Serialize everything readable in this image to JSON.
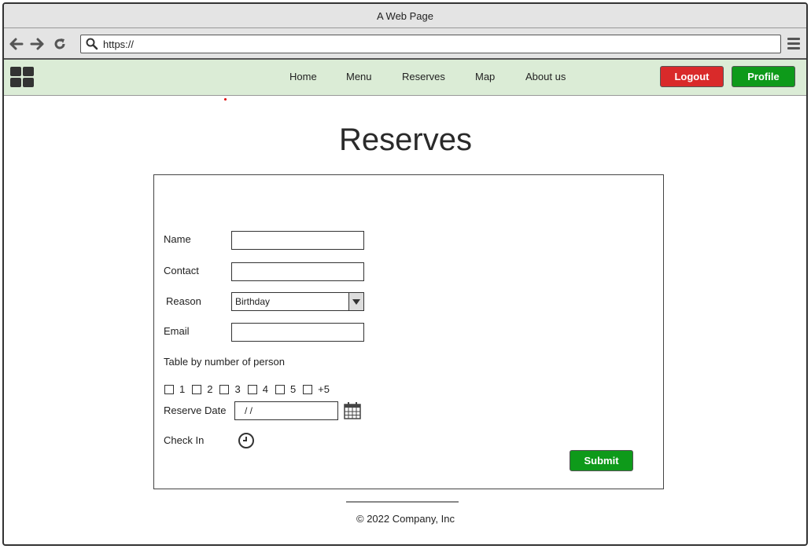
{
  "browser": {
    "window_title": "A Web Page",
    "url": "https://"
  },
  "nav": {
    "links": [
      "Home",
      "Menu",
      "Reserves",
      "Map",
      "About us"
    ],
    "logout_label": "Logout",
    "profile_label": "Profile"
  },
  "page": {
    "title": "Reserves"
  },
  "form": {
    "name_label": "Name",
    "name_value": "",
    "contact_label": "Contact",
    "contact_value": "",
    "reason_label": "Reason",
    "reason_value": "Birthday",
    "email_label": "Email",
    "email_value": "",
    "table_label": "Table by number of person",
    "table_options": [
      "1",
      "2",
      "3",
      "4",
      "5",
      "+5"
    ],
    "date_label": "Reserve Date",
    "date_value": "/  /",
    "checkin_label": "Check In",
    "submit_label": "Submit"
  },
  "footer": {
    "text": "© 2022 Company, Inc"
  },
  "colors": {
    "navbar_bg": "#dbecd6",
    "logout_bg": "#d92a2a",
    "profile_bg": "#0e9a1a",
    "submit_bg": "#0e9a1a"
  }
}
